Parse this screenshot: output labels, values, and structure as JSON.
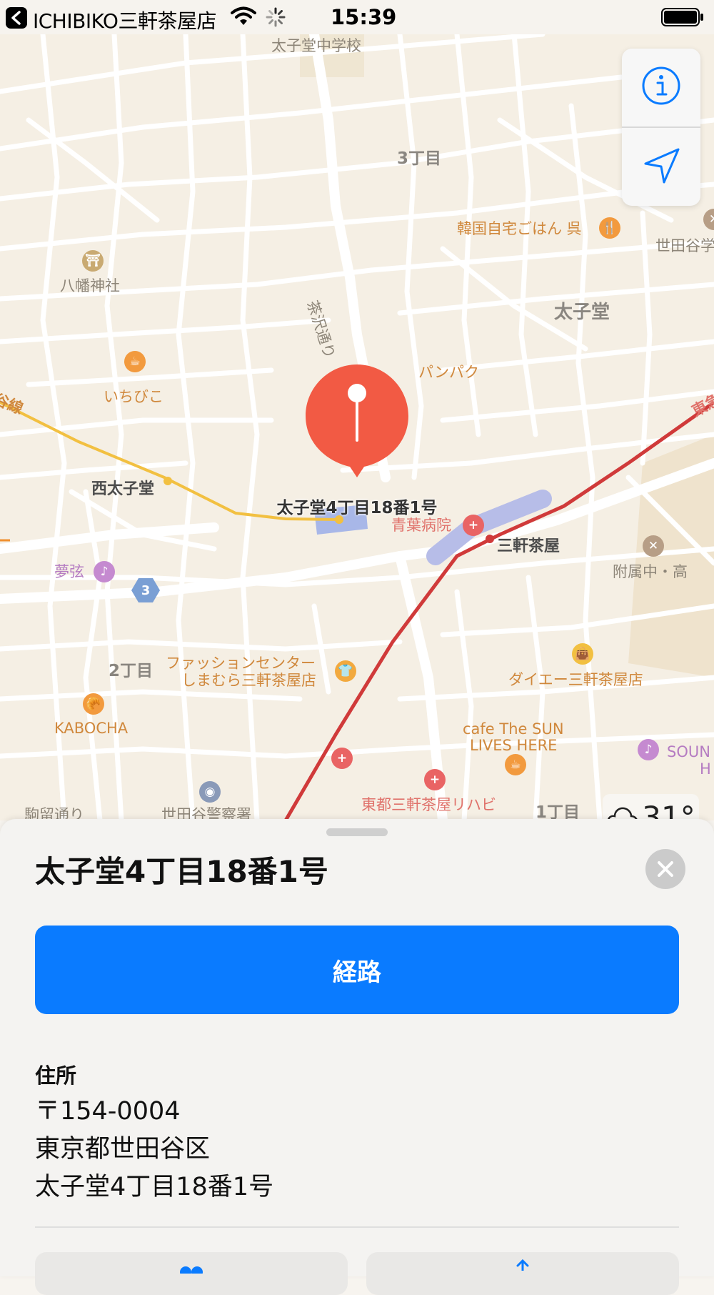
{
  "status_bar": {
    "back_app": "ICHIBIKO三軒茶屋店",
    "time": "15:39"
  },
  "map": {
    "labels": {
      "taishido_jhs": "太子堂中学校",
      "chome3": "3丁目",
      "korean_restaurant": "韓国自宅ごはん 呉",
      "setagaya_school": "世田谷学",
      "yawata_shrine": "八幡神社",
      "chazawa_dori": "茶沢通り",
      "taishido": "太子堂",
      "panpaku": "パンパク",
      "ichibiko": "いちびこ",
      "line_left": "谷線",
      "nishi_taishido": "西太子堂",
      "aoba_hospital": "青葉病院",
      "sangenjaya": "三軒茶屋",
      "fuzoku_school": "附属中・高",
      "mugen": "夢弦",
      "route_number": "3",
      "chome2": "2丁目",
      "fashion_center_1": "ファッションセンター",
      "fashion_center_2": "しまむら三軒茶屋店",
      "daiei": "ダイエー三軒茶屋店",
      "kabocha": "KABOCHA",
      "cafe_sun_1": "cafe The SUN",
      "cafe_sun_2": "LIVES HERE",
      "sound_1": "SOUN",
      "sound_2": "H",
      "rehab_1": "東都三軒茶屋リハビ",
      "chome1": "1丁目",
      "komaba_dori": "駒留通り",
      "police": "世田谷警察署",
      "toyoko_line": "東急"
    },
    "pin_label": "太子堂4丁目18番1号",
    "weather": {
      "icon": "cloud-icon",
      "temp": "31°"
    }
  },
  "sheet": {
    "title": "太子堂4丁目18番1号",
    "route_button": "経路",
    "address_heading": "住所",
    "address_lines": [
      "〒154-0004",
      "東京都世田谷区",
      "太子堂4丁目18番1号"
    ]
  },
  "colors": {
    "accent": "#0a7bff",
    "pin": "#f25a44",
    "rail": "#d03a3a",
    "rail_yellow": "#f2c041",
    "map_bg": "#f5efe4"
  }
}
